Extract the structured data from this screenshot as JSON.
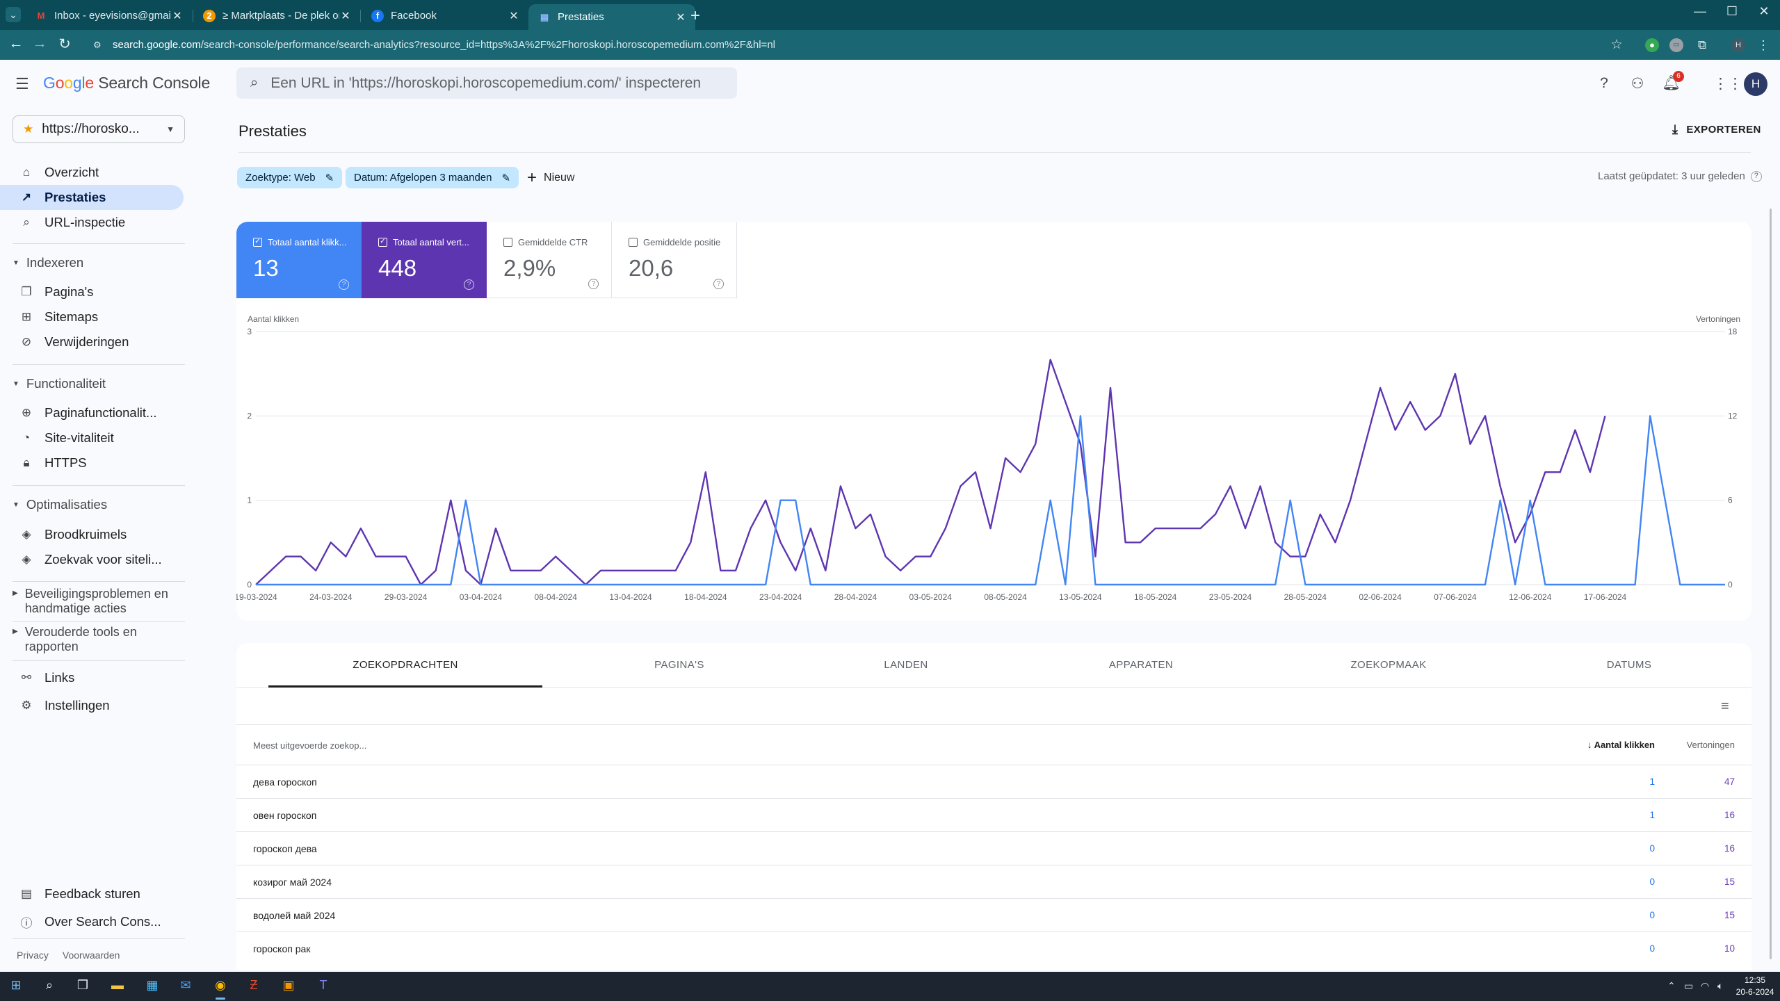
{
  "browser": {
    "tabs": [
      {
        "title": "Inbox - eyevisions@gmail.com",
        "icon": "gmail-icon",
        "active": false
      },
      {
        "title": "≥ Marktplaats - De plek om nie",
        "icon": "marktplaats-icon",
        "active": false
      },
      {
        "title": "Facebook",
        "icon": "facebook-icon",
        "active": false
      },
      {
        "title": "Prestaties",
        "icon": "search-console-icon",
        "active": true
      }
    ],
    "url_host": "search.google.com",
    "url_path": "/search-console/performance/search-analytics?resource_id=https%3A%2F%2Fhoroskopi.horoscopemedium.com%2F&hl=nl",
    "profile_initial": "H"
  },
  "header": {
    "app_name": "Search Console",
    "search_placeholder": "Een URL in 'https://horoskopi.horoscopemedium.com/' inspecteren",
    "notification_count": "6",
    "avatar_initial": "H"
  },
  "sidebar": {
    "property": "https://horosko...",
    "items": [
      {
        "label": "Overzicht",
        "icon": "home-icon"
      },
      {
        "label": "Prestaties",
        "icon": "trending-up-icon",
        "active": true
      },
      {
        "label": "URL-inspectie",
        "icon": "search-icon"
      }
    ],
    "sections": [
      {
        "title": "Indexeren",
        "items": [
          {
            "label": "Pagina's",
            "icon": "pages-icon"
          },
          {
            "label": "Sitemaps",
            "icon": "sitemap-icon"
          },
          {
            "label": "Verwijderingen",
            "icon": "eye-off-icon"
          }
        ]
      },
      {
        "title": "Functionaliteit",
        "items": [
          {
            "label": "Paginafunctionalit...",
            "icon": "add-circle-icon"
          },
          {
            "label": "Site-vitaliteit",
            "icon": "speed-icon"
          },
          {
            "label": "HTTPS",
            "icon": "lock-icon"
          }
        ]
      },
      {
        "title": "Optimalisaties",
        "items": [
          {
            "label": "Broodkruimels",
            "icon": "layers-icon"
          },
          {
            "label": "Zoekvak voor siteli...",
            "icon": "layers-icon"
          }
        ]
      }
    ],
    "collapsed_groups": [
      [
        "Beveiligingsproblemen en",
        "handmatige acties"
      ],
      [
        "Verouderde tools en",
        "rapporten"
      ]
    ],
    "bottom_items": [
      {
        "label": "Links",
        "icon": "links-icon"
      },
      {
        "label": "Instellingen",
        "icon": "settings-icon"
      }
    ],
    "feedback": "Feedback sturen",
    "about": "Over Search Cons...",
    "footer": [
      "Privacy",
      "Voorwaarden"
    ]
  },
  "main": {
    "title": "Prestaties",
    "export_label": "EXPORTEREN",
    "filters": [
      "Zoektype: Web",
      "Datum: Afgelopen 3 maanden"
    ],
    "new_filter": "Nieuw",
    "last_updated": "Laatst geüpdatet: 3 uur geleden",
    "metrics": [
      {
        "label": "Totaal aantal klikk...",
        "value": "13",
        "checked": true,
        "color": "#4285f4"
      },
      {
        "label": "Totaal aantal vert...",
        "value": "448",
        "checked": true,
        "color": "#5e35b1"
      },
      {
        "label": "Gemiddelde CTR",
        "value": "2,9%",
        "checked": false
      },
      {
        "label": "Gemiddelde positie",
        "value": "20,6",
        "checked": false
      }
    ]
  },
  "chart_data": {
    "type": "line",
    "title": "",
    "ylabel_left": "Aantal klikken",
    "ylabel_right": "Vertoningen",
    "ylim_left": [
      0,
      3
    ],
    "ylim_right": [
      0,
      18
    ],
    "yticks_left": [
      "0",
      "1",
      "2",
      "3"
    ],
    "yticks_right": [
      "0",
      "6",
      "12",
      "18"
    ],
    "xtick_labels": [
      "19-03-2024",
      "24-03-2024",
      "29-03-2024",
      "03-04-2024",
      "08-04-2024",
      "13-04-2024",
      "18-04-2024",
      "23-04-2024",
      "28-04-2024",
      "03-05-2024",
      "08-05-2024",
      "13-05-2024",
      "18-05-2024",
      "23-05-2024",
      "28-05-2024",
      "02-06-2024",
      "07-06-2024",
      "12-06-2024",
      "17-06-2024"
    ],
    "grid": true,
    "series": [
      {
        "name": "Aantal klikken",
        "axis": "left",
        "color": "#4285f4",
        "values": [
          0,
          0,
          0,
          0,
          0,
          0,
          0,
          0,
          0,
          0,
          0,
          0,
          0,
          0,
          1,
          0,
          0,
          0,
          0,
          0,
          0,
          0,
          0,
          0,
          0,
          0,
          0,
          0,
          0,
          0,
          0,
          0,
          0,
          0,
          0,
          1,
          1,
          0,
          0,
          0,
          0,
          0,
          0,
          0,
          0,
          0,
          0,
          0,
          0,
          0,
          0,
          0,
          0,
          1,
          0,
          2,
          0,
          0,
          0,
          0,
          0,
          0,
          0,
          0,
          0,
          0,
          0,
          0,
          0,
          1,
          0,
          0,
          0,
          0,
          0,
          0,
          0,
          0,
          0,
          0,
          0,
          0,
          0,
          1,
          0,
          1,
          0,
          0,
          0,
          0,
          0,
          0,
          0,
          2,
          1,
          0,
          0,
          0,
          0
        ]
      },
      {
        "name": "Vertoningen",
        "axis": "right",
        "color": "#5e35b1",
        "values": [
          0,
          1,
          2,
          2,
          1,
          3,
          2,
          4,
          2,
          2,
          2,
          0,
          1,
          6,
          1,
          0,
          4,
          1,
          1,
          1,
          2,
          1,
          0,
          1,
          1,
          1,
          1,
          1,
          1,
          3,
          8,
          1,
          1,
          4,
          6,
          3,
          1,
          4,
          1,
          7,
          4,
          5,
          2,
          1,
          2,
          2,
          4,
          7,
          8,
          4,
          9,
          8,
          10,
          16,
          13,
          10,
          2,
          14,
          3,
          3,
          4,
          4,
          4,
          4,
          5,
          7,
          4,
          7,
          3,
          2,
          2,
          5,
          3,
          6,
          10,
          14,
          11,
          13,
          11,
          12,
          15,
          10,
          12,
          7,
          3,
          5,
          8,
          8,
          11,
          8,
          12
        ]
      }
    ]
  },
  "table": {
    "tabs": [
      "ZOEKOPDRACHTEN",
      "PAGINA'S",
      "LANDEN",
      "APPARATEN",
      "ZOEKOPMAAK",
      "DATUMS"
    ],
    "col_query": "Meest uitgevoerde zoekop...",
    "col_clicks": "Aantal klikken",
    "col_impressions": "Vertoningen",
    "rows": [
      {
        "query": "дева гороскоп",
        "clicks": "1",
        "impressions": "47"
      },
      {
        "query": "овен гороскоп",
        "clicks": "1",
        "impressions": "16"
      },
      {
        "query": "гороскоп дева",
        "clicks": "0",
        "impressions": "16"
      },
      {
        "query": "козирог май 2024",
        "clicks": "0",
        "impressions": "15"
      },
      {
        "query": "водолей май 2024",
        "clicks": "0",
        "impressions": "15"
      },
      {
        "query": "гороскоп рак",
        "clicks": "0",
        "impressions": "10"
      }
    ]
  },
  "taskbar": {
    "time": "12:35",
    "date": "20-6-2024"
  }
}
